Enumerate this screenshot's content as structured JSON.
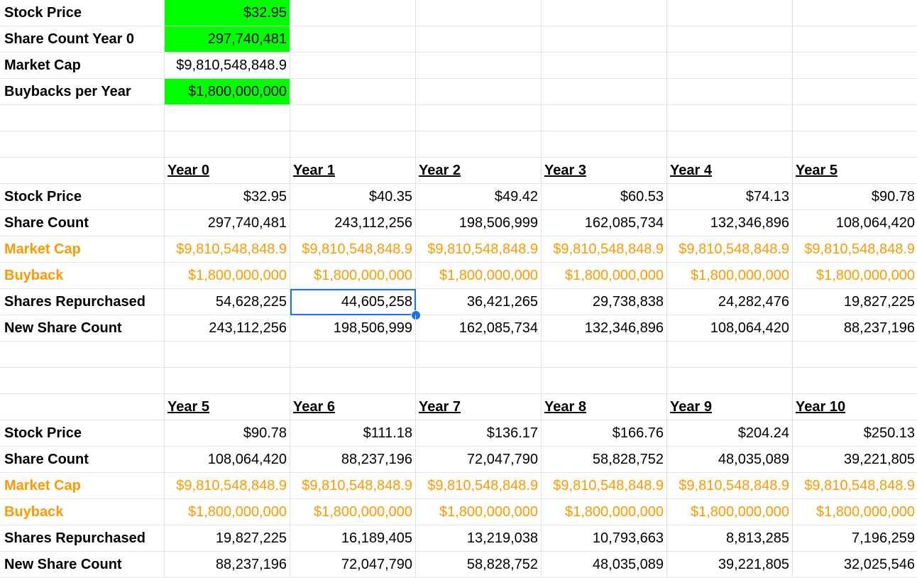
{
  "params": [
    {
      "label": "Stock Price",
      "value": "$32.95",
      "highlight": true
    },
    {
      "label": "Share Count Year 0",
      "value": "297,740,481",
      "highlight": true
    },
    {
      "label": "Market Cap",
      "value": "$9,810,548,848.9",
      "highlight": false
    },
    {
      "label": "Buybacks per Year",
      "value": "$1,800,000,000",
      "highlight": true
    }
  ],
  "tables": [
    {
      "years": [
        "Year 0",
        "Year 1",
        "Year 2",
        "Year 3",
        "Year 4",
        "Year 5"
      ],
      "rows": [
        {
          "label": "Stock Price",
          "style": "normal",
          "values": [
            "$32.95",
            "$40.35",
            "$49.42",
            "$60.53",
            "$74.13",
            "$90.78"
          ]
        },
        {
          "label": "Share Count",
          "style": "normal",
          "values": [
            "297,740,481",
            "243,112,256",
            "198,506,999",
            "162,085,734",
            "132,346,896",
            "108,064,420"
          ]
        },
        {
          "label": "Market Cap",
          "style": "orange",
          "values": [
            "$9,810,548,848.9",
            "$9,810,548,848.9",
            "$9,810,548,848.9",
            "$9,810,548,848.9",
            "$9,810,548,848.9",
            "$9,810,548,848.9"
          ]
        },
        {
          "label": "Buyback",
          "style": "orange",
          "values": [
            "$1,800,000,000",
            "$1,800,000,000",
            "$1,800,000,000",
            "$1,800,000,000",
            "$1,800,000,000",
            "$1,800,000,000"
          ]
        },
        {
          "label": "Shares Repurchased",
          "style": "normal",
          "values": [
            "54,628,225",
            "44,605,258",
            "36,421,265",
            "29,738,838",
            "24,282,476",
            "19,827,225"
          ]
        },
        {
          "label": "New Share Count",
          "style": "normal",
          "values": [
            "243,112,256",
            "198,506,999",
            "162,085,734",
            "132,346,896",
            "108,064,420",
            "88,237,196"
          ]
        }
      ]
    },
    {
      "years": [
        "Year 5",
        "Year 6",
        "Year 7",
        "Year 8",
        "Year 9",
        "Year 10"
      ],
      "rows": [
        {
          "label": "Stock Price",
          "style": "normal",
          "values": [
            "$90.78",
            "$111.18",
            "$136.17",
            "$166.76",
            "$204.24",
            "$250.13"
          ]
        },
        {
          "label": "Share Count",
          "style": "normal",
          "values": [
            "108,064,420",
            "88,237,196",
            "72,047,790",
            "58,828,752",
            "48,035,089",
            "39,221,805"
          ]
        },
        {
          "label": "Market Cap",
          "style": "orange",
          "values": [
            "$9,810,548,848.9",
            "$9,810,548,848.9",
            "$9,810,548,848.9",
            "$9,810,548,848.9",
            "$9,810,548,848.9",
            "$9,810,548,848.9"
          ]
        },
        {
          "label": "Buyback",
          "style": "orange",
          "values": [
            "$1,800,000,000",
            "$1,800,000,000",
            "$1,800,000,000",
            "$1,800,000,000",
            "$1,800,000,000",
            "$1,800,000,000"
          ]
        },
        {
          "label": "Shares Repurchased",
          "style": "normal",
          "values": [
            "19,827,225",
            "16,189,405",
            "13,219,038",
            "10,793,663",
            "8,813,285",
            "7,196,259"
          ]
        },
        {
          "label": "New Share Count",
          "style": "normal",
          "values": [
            "88,237,196",
            "72,047,790",
            "58,828,752",
            "48,035,089",
            "39,221,805",
            "32,025,546"
          ]
        }
      ]
    }
  ],
  "selected_cell": {
    "table": 0,
    "row": 4,
    "col": 1
  },
  "colors": {
    "highlight": "#00ff00",
    "orange": "#ff9900",
    "selection": "#1a73e8",
    "grid": "#e2e2e2"
  }
}
